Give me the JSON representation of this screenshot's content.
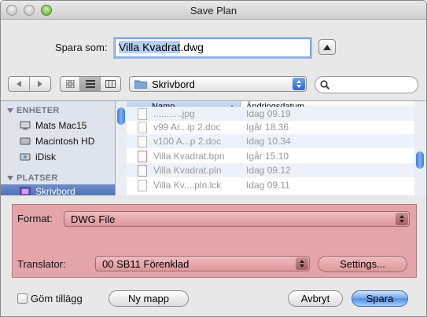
{
  "window": {
    "title": "Save Plan"
  },
  "save_as": {
    "label": "Spara som:",
    "selected_text": "Villa Kvadrat",
    "extension": ".dwg"
  },
  "toolbar": {
    "location": "Skrivbord",
    "search_placeholder": ""
  },
  "sidebar": {
    "sections": [
      {
        "title": "ENHETER",
        "items": [
          {
            "label": "Mats Mac15",
            "icon": "computer-icon"
          },
          {
            "label": "Macintosh HD",
            "icon": "hard-drive-icon"
          },
          {
            "label": "iDisk",
            "icon": "idisk-icon"
          }
        ]
      },
      {
        "title": "PLATSER",
        "items": [
          {
            "label": "Skrivbord",
            "icon": "desktop-folder-icon",
            "selected": true
          }
        ]
      }
    ]
  },
  "file_list": {
    "columns": {
      "name": "Namn",
      "date": "Ändringsdatum"
    },
    "rows": [
      {
        "name": "...........jpg",
        "date": "Idag 09.19"
      },
      {
        "name": "v99 Ar...ip 2.doc",
        "date": "Igår 18.36"
      },
      {
        "name": "v100 A...p 2.doc",
        "date": "Idag 10.34"
      },
      {
        "name": "Villa Kvadrat.bpn",
        "date": "Igår 15.10"
      },
      {
        "name": "Villa Kvadrat.pln",
        "date": "Idag 09.12"
      },
      {
        "name": "Villa Kv....pln.lck",
        "date": "Idag 09.11"
      }
    ]
  },
  "options": {
    "format_label": "Format:",
    "format_value": "DWG File",
    "translator_label": "Translator:",
    "translator_value": "00 SB11 Förenklad",
    "settings_button": "Settings..."
  },
  "footer": {
    "hide_extension_label": "Göm tillägg",
    "new_folder_button": "Ny mapp",
    "cancel_button": "Avbryt",
    "save_button": "Spara"
  },
  "colors": {
    "accessory_bg": "#e3a5a9",
    "selection": "#4a6db4",
    "default_button": "#4d8ee6"
  }
}
